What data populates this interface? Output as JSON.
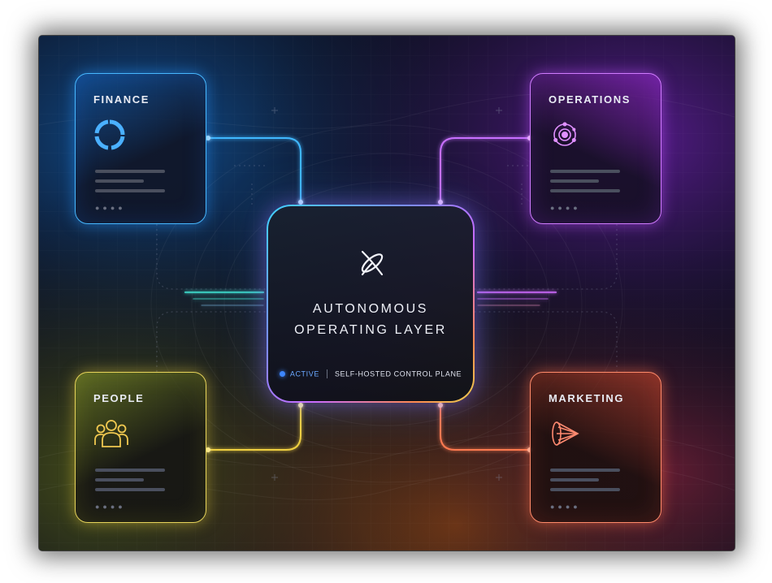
{
  "center": {
    "icon": "orbit-x-logo-icon",
    "title_line1": "AUTONOMOUS",
    "title_line2": "OPERATING LAYER",
    "status_label": "ACTIVE",
    "status_text": "SELF-HOSTED CONTROL PLANE",
    "status_color": "#3d86ff"
  },
  "cards": {
    "finance": {
      "label": "FINANCE",
      "icon": "pie-ring-icon",
      "color": "#47b8ff"
    },
    "operations": {
      "label": "OPERATIONS",
      "icon": "atom-orbit-icon",
      "color": "#d07bff"
    },
    "people": {
      "label": "PEOPLE",
      "icon": "users-group-icon",
      "color": "#e6d35a"
    },
    "marketing": {
      "label": "MARKETING",
      "icon": "cone-funnel-icon",
      "color": "#ff8a6a"
    }
  }
}
